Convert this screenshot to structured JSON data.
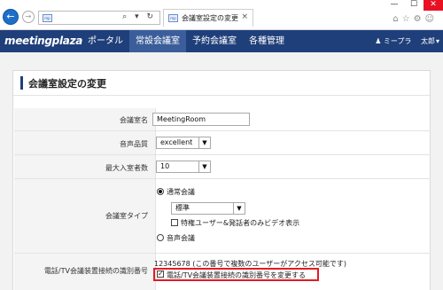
{
  "browser": {
    "tab_title": "会議室設定の変更",
    "favicon_text": "mp",
    "address_icons": "⌕ ▾ ↻",
    "window_controls": [
      "—",
      "☐",
      "✕"
    ],
    "toolbar_icons": [
      "⌂",
      "☆",
      "⚙",
      "☺"
    ]
  },
  "header": {
    "logo": "meetingplaza",
    "menu": [
      {
        "label": "ポータル"
      },
      {
        "label": "常設会議室"
      },
      {
        "label": "予約会議室"
      },
      {
        "label": "各種管理"
      }
    ],
    "user_group": "ミープラ",
    "user_name": "太郎"
  },
  "page": {
    "title": "会議室設定の変更"
  },
  "form": {
    "room_name": {
      "label": "会議室名",
      "value": "MeetingRoom"
    },
    "audio_quality": {
      "label": "音声品質",
      "value": "excellent"
    },
    "max_participants": {
      "label": "最大入室者数",
      "value": "10"
    },
    "room_type": {
      "label": "会議室タイプ",
      "option_normal": "通常会議",
      "sub_select_value": "標準",
      "checkbox_video": "特権ユーザー&発話者のみビデオ表示",
      "option_audio": "音声会議"
    },
    "phone_id": {
      "label": "電話/TV会議装置接続の識別番号",
      "note": "12345678 (この番号で複数のユーザーがアクセス可能です)",
      "checkbox_change": "電話/TV会議装置接続の識別番号を変更する"
    }
  },
  "colors": {
    "header_bg": "#1f3f7a",
    "menu_active": "#3b5e9b",
    "highlight": "#e31b23"
  }
}
